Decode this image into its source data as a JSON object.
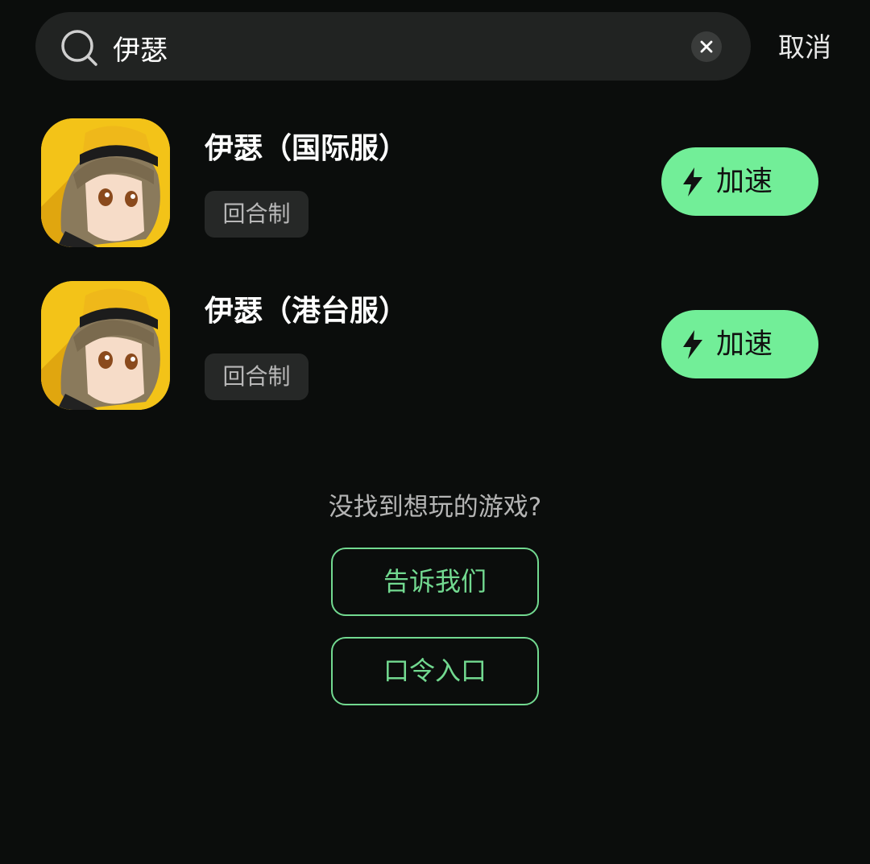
{
  "search": {
    "value": "伊瑟",
    "cancel_label": "取消",
    "icon": "search-icon",
    "clear_icon": "close-icon"
  },
  "games": [
    {
      "title": "伊瑟（国际服）",
      "tag": "回合制",
      "button_label": "加速",
      "button_icon": "lightning-bolt-icon"
    },
    {
      "title": "伊瑟（港台服）",
      "tag": "回合制",
      "button_label": "加速",
      "button_icon": "lightning-bolt-icon"
    }
  ],
  "footer": {
    "prompt": "没找到想玩的游戏?",
    "tell_us_label": "告诉我们",
    "code_entry_label": "口令入口"
  },
  "colors": {
    "background": "#0b0d0c",
    "accent": "#72ee98",
    "outline_accent": "#72d990",
    "search_bg": "#212322",
    "tag_bg": "#262827"
  }
}
